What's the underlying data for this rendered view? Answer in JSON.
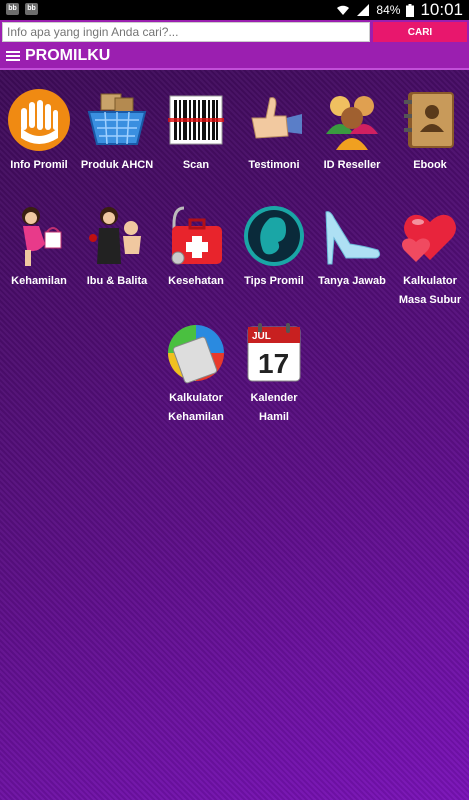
{
  "status_bar": {
    "left_icons": [
      "bbm-icon",
      "bbm-icon"
    ],
    "battery_percent": "84%",
    "time": "10:01"
  },
  "search": {
    "placeholder": "Info apa yang ingin Anda cari?...",
    "button_label": "CARI"
  },
  "app_bar": {
    "title": "PROMILKU"
  },
  "menu": [
    {
      "label": "Info Promil",
      "icon": "hands-icon"
    },
    {
      "label": "Produk AHCN",
      "icon": "shopping-basket-icon"
    },
    {
      "label": "Scan",
      "icon": "barcode-icon"
    },
    {
      "label": "Testimoni",
      "icon": "thumbs-up-icon"
    },
    {
      "label": "ID Reseller",
      "icon": "people-icon"
    },
    {
      "label": "Ebook",
      "icon": "address-book-icon"
    },
    {
      "label": "Kehamilan",
      "icon": "pregnant-woman-icon"
    },
    {
      "label": "Ibu & Balita",
      "icon": "mother-baby-icon"
    },
    {
      "label": "Kesehatan",
      "icon": "first-aid-kit-icon"
    },
    {
      "label": "Tips Promil",
      "icon": "fetus-icon"
    },
    {
      "label": "Tanya Jawab",
      "icon": "high-heel-icon"
    },
    {
      "label": "Kalkulator Masa Subur",
      "icon": "hearts-icon"
    },
    {
      "label": "Kalkulator Kehamilan",
      "icon": "calculator-icon"
    },
    {
      "label": "Kalender Hamil",
      "icon": "calendar-icon"
    }
  ],
  "calendar_icon": {
    "month": "JUL",
    "day": "17"
  }
}
